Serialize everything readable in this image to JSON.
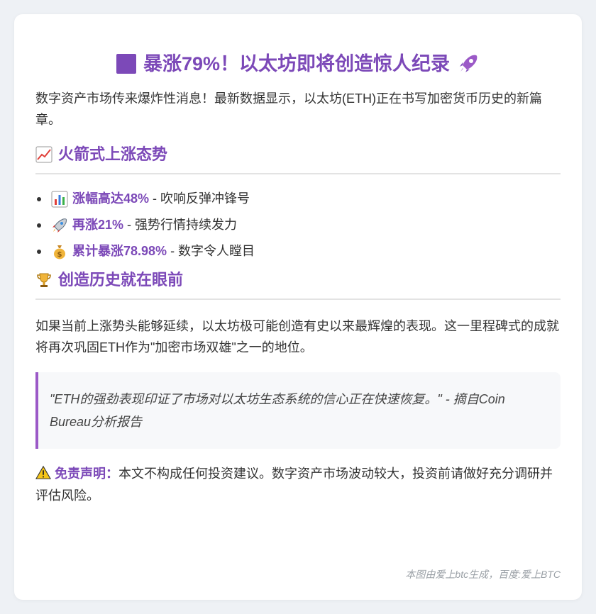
{
  "title": {
    "text": "暴涨79%！以太坊即将创造惊人纪录",
    "left_icon": "purple-square-icon",
    "right_icon": "rocket-icon"
  },
  "intro": "数字资产市场传来爆炸性消息！最新数据显示，以太坊(ETH)正在书写加密货币历史的新篇章。",
  "section1": {
    "heading": "火箭式上涨态势",
    "icon": "chart-up-icon",
    "items": [
      {
        "icon": "bar-chart-icon",
        "highlight": "涨幅高达48%",
        "text": " - 吹响反弹冲锋号"
      },
      {
        "icon": "rocket-icon",
        "highlight": "再涨21%",
        "text": " - 强势行情持续发力"
      },
      {
        "icon": "money-bag-icon",
        "highlight": "累计暴涨78.98%",
        "text": " - 数字令人瞠目"
      }
    ]
  },
  "section2": {
    "heading": "创造历史就在眼前",
    "icon": "trophy-icon",
    "paragraph": "如果当前上涨势头能够延续，以太坊极可能创造有史以来最辉煌的表现。这一里程碑式的成就将再次巩固ETH作为\"加密市场双雄\"之一的地位。"
  },
  "quote": "\"ETH的强劲表现印证了市场对以太坊生态系统的信心正在快速恢复。\" - 摘自Coin Bureau分析报告",
  "disclaimer": {
    "icon": "warning-icon",
    "label": "免责声明：",
    "text": "本文不构成任何投资建议。数字资产市场波动较大，投资前请做好充分调研并评估风险。"
  },
  "footer": "本图由爱上btc生成，百度:爱上BTC",
  "colors": {
    "accent": "#7c49b8",
    "quote_border": "#9b59c7",
    "background": "#eef1f5"
  }
}
